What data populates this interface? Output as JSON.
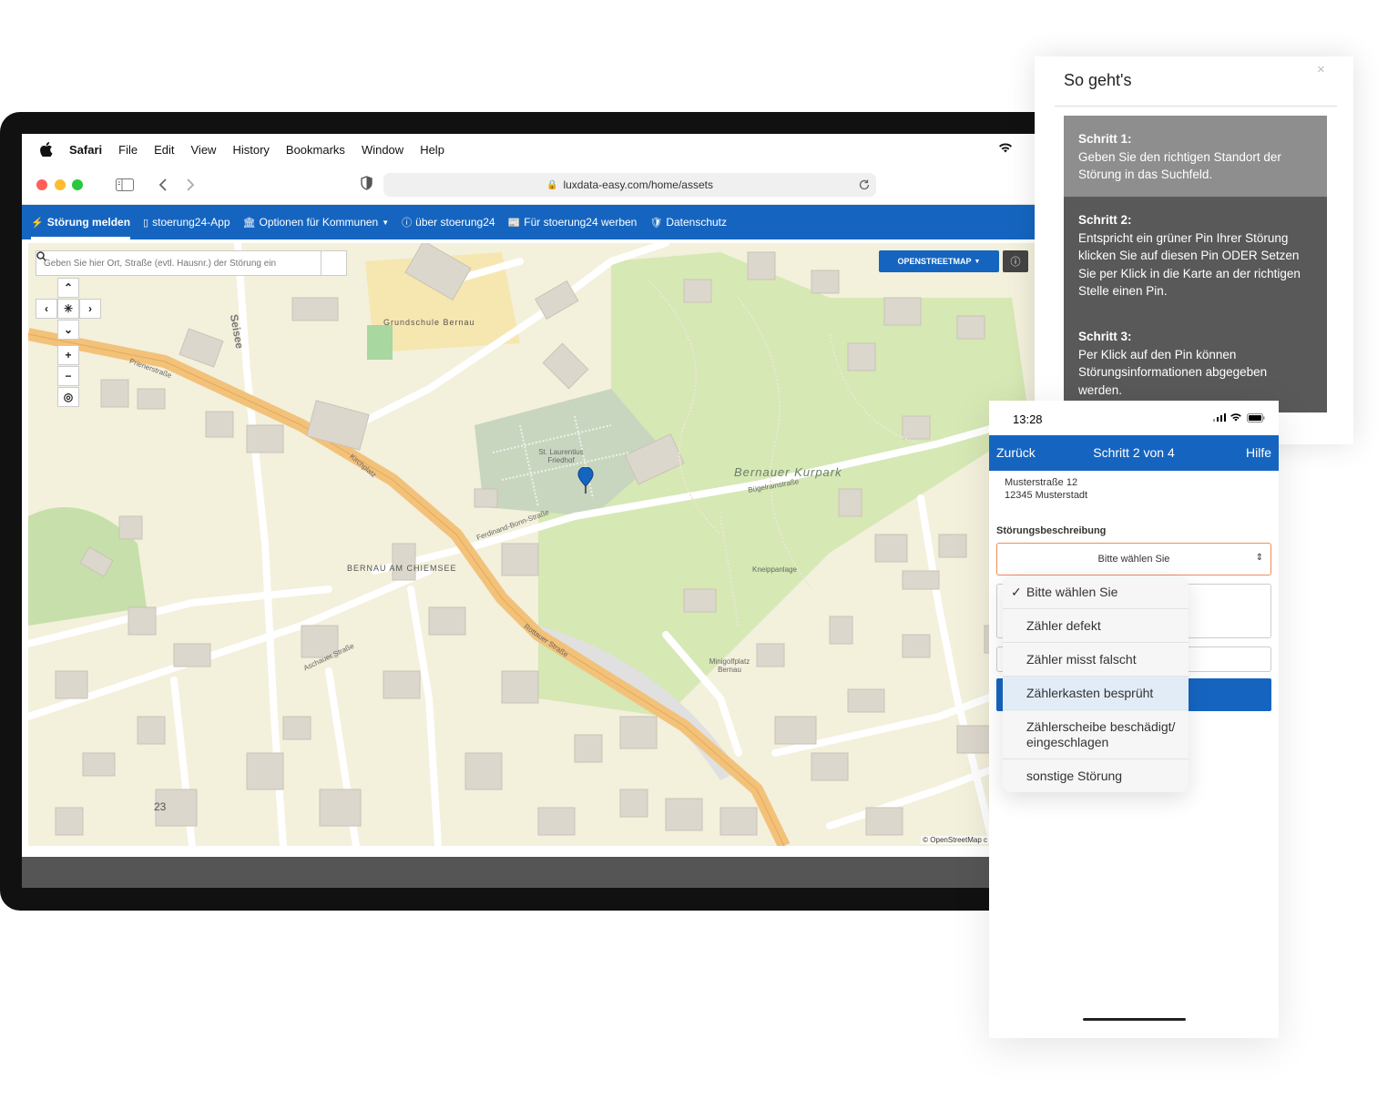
{
  "menubar": {
    "app": "Safari",
    "items": [
      "File",
      "Edit",
      "View",
      "History",
      "Bookmarks",
      "Window",
      "Help"
    ]
  },
  "browser": {
    "url": "luxdata-easy.com/home/assets"
  },
  "sitenav": {
    "items": [
      {
        "icon": "bolt-icon",
        "label": "Störung melden"
      },
      {
        "icon": "phone-icon",
        "label": "stoerung24-App"
      },
      {
        "icon": "building-icon",
        "label": "Optionen für Kommunen"
      },
      {
        "icon": "info-icon",
        "label": "über stoerung24"
      },
      {
        "icon": "newspaper-icon",
        "label": "Für stoerung24 werben"
      },
      {
        "icon": "shield-icon",
        "label": "Datenschutz"
      }
    ]
  },
  "map": {
    "search_placeholder": "Geben Sie hier Ort, Straße (evtl. Hausnr.) der Störung ein",
    "layer_button": "OPENSTREETMAP",
    "attribution": "© OpenStreetMap c",
    "labels": {
      "school": "Grundschule Bernau",
      "cemetery": "St. Laurentius Friedhof",
      "park": "Bernauer Kurpark",
      "town": "BERNAU AM CHIEMSEE",
      "prien": "Prienerstraße",
      "kirchplatz": "Kirchplatz",
      "rottauer": "Rottauer Straße",
      "aschauer": "Aschauer Straße",
      "buegelrain": "Bügelrainstraße",
      "seisee": "Seisee",
      "ferdinand": "Ferdinand-Bonn-Straße",
      "kneipp": "Kneippanlage",
      "minigolf": "Minigolfplatz Bernau",
      "num23": "23"
    }
  },
  "help": {
    "title": "So geht's",
    "close": "×",
    "steps": [
      {
        "title": "Schritt 1:",
        "text": "Geben Sie den richtigen Standort der Störung in das Suchfeld."
      },
      {
        "title": "Schritt 2:",
        "text": "Entspricht ein grüner Pin Ihrer Störung klicken Sie auf diesen Pin ODER Setzen Sie per Klick in die Karte an der richtigen Stelle einen Pin."
      },
      {
        "title": "Schritt 3:",
        "text": "Per Klick auf den Pin können Störungsinformationen abgegeben werden."
      }
    ]
  },
  "phone": {
    "time": "13:28",
    "back": "Zurück",
    "title": "Schritt 2 von 4",
    "help": "Hilfe",
    "address_line1": "Musterstraße 12",
    "address_line2": "12345 Musterstadt",
    "field_label": "Störungsbeschreibung",
    "select_value": "Bitte wählen Sie",
    "options": [
      {
        "label": "Bitte wählen Sie",
        "checked": true
      },
      {
        "label": "Zähler defekt"
      },
      {
        "label": "Zähler misst falscht"
      },
      {
        "label": "Zählerkasten besprüht"
      },
      {
        "label": "Zählerscheibe beschädigt/ eingeschlagen"
      },
      {
        "label": "sonstige Störung"
      }
    ]
  }
}
